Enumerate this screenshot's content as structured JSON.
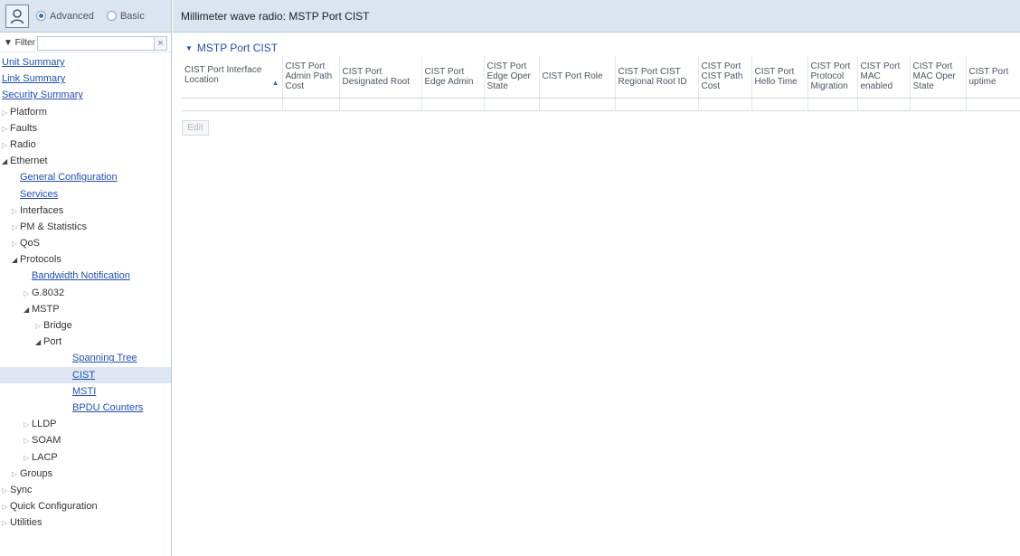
{
  "header": {
    "mode_options": [
      {
        "label": "Advanced",
        "selected": true
      },
      {
        "label": "Basic",
        "selected": false
      }
    ],
    "breadcrumb": "Millimeter wave radio: MSTP Port CIST"
  },
  "filter": {
    "label": "▼ Filter",
    "value": "",
    "clear": "×"
  },
  "sidebar": {
    "items": [
      {
        "label": "Unit Summary",
        "indent": 0,
        "arrow": "",
        "link": true
      },
      {
        "label": "Link Summary",
        "indent": 0,
        "arrow": "",
        "link": true
      },
      {
        "label": "Security Summary",
        "indent": 0,
        "arrow": "",
        "link": true
      },
      {
        "label": "Platform",
        "indent": 0,
        "arrow": "▷",
        "link": false
      },
      {
        "label": "Faults",
        "indent": 0,
        "arrow": "▷",
        "link": false
      },
      {
        "label": "Radio",
        "indent": 0,
        "arrow": "▷",
        "link": false
      },
      {
        "label": "Ethernet",
        "indent": 0,
        "arrow": "◢",
        "link": false
      },
      {
        "label": "General Configuration",
        "indent": 1,
        "arrow": "",
        "link": true
      },
      {
        "label": "Services",
        "indent": 1,
        "arrow": "",
        "link": true
      },
      {
        "label": "Interfaces",
        "indent": 1,
        "arrow": "▷",
        "link": false
      },
      {
        "label": "PM & Statistics",
        "indent": 1,
        "arrow": "▷",
        "link": false
      },
      {
        "label": "QoS",
        "indent": 1,
        "arrow": "▷",
        "link": false
      },
      {
        "label": "Protocols",
        "indent": 1,
        "arrow": "◢",
        "link": false
      },
      {
        "label": "Bandwidth Notification",
        "indent": 2,
        "arrow": "",
        "link": true
      },
      {
        "label": "G.8032",
        "indent": 2,
        "arrow": "▷",
        "link": false
      },
      {
        "label": "MSTP",
        "indent": 2,
        "arrow": "◢",
        "link": false
      },
      {
        "label": "Bridge",
        "indent": 3,
        "arrow": "▷",
        "link": false
      },
      {
        "label": "Port",
        "indent": 3,
        "arrow": "◢",
        "link": false
      },
      {
        "label": "Spanning Tree",
        "indent": 4,
        "arrow": "",
        "link": true
      },
      {
        "label": "CIST",
        "indent": 4,
        "arrow": "",
        "link": true,
        "selected": true
      },
      {
        "label": "MSTI",
        "indent": 4,
        "arrow": "",
        "link": true
      },
      {
        "label": "BPDU Counters",
        "indent": 4,
        "arrow": "",
        "link": true
      },
      {
        "label": "LLDP",
        "indent": 2,
        "arrow": "▷",
        "link": false
      },
      {
        "label": "SOAM",
        "indent": 2,
        "arrow": "▷",
        "link": false
      },
      {
        "label": "LACP",
        "indent": 2,
        "arrow": "▷",
        "link": false
      },
      {
        "label": "Groups",
        "indent": 1,
        "arrow": "▷",
        "link": false
      },
      {
        "label": "Sync",
        "indent": 0,
        "arrow": "▷",
        "link": false
      },
      {
        "label": "Quick Configuration",
        "indent": 0,
        "arrow": "▷",
        "link": false
      },
      {
        "label": "Utilities",
        "indent": 0,
        "arrow": "▷",
        "link": false
      }
    ]
  },
  "section": {
    "title": "MSTP Port CIST",
    "expand_icon": "▼"
  },
  "table": {
    "sort_icon": "▲",
    "columns": [
      "CIST Port Interface Location",
      "CIST Port Admin Path Cost",
      "CIST Port Designated Root",
      "CIST Port Edge Admin",
      "CIST Port Edge Oper State",
      "CIST Port Role",
      "CIST Port CIST Regional Root ID",
      "CIST Port CIST Path Cost",
      "CIST Port Hello Time",
      "CIST Port Protocol Migration",
      "CIST Port MAC enabled",
      "CIST Port MAC Oper State",
      "CIST Port uptime"
    ]
  },
  "actions": {
    "edit_label": "Edit"
  },
  "colors": {
    "header_bg": "#dbe5ef",
    "link": "#1f4fb4",
    "selected_row": "#dde6f1"
  }
}
